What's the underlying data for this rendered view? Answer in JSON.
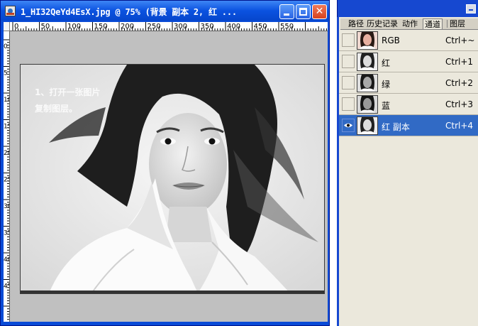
{
  "window": {
    "title": "1_HI32QeYd4EsX.jpg @ 75% (背景 副本 2, 红 ...",
    "minimize_glyph": "_",
    "maximize_glyph": "□",
    "close_glyph": "✕"
  },
  "rulers": {
    "horizontal_labels": [
      "0",
      "50",
      "100",
      "150",
      "200",
      "250",
      "300",
      "350",
      "400",
      "450",
      "550"
    ],
    "vertical_labels": [
      "0",
      "5",
      "10",
      "15",
      "20",
      "25",
      "30",
      "35",
      "40",
      "45"
    ]
  },
  "image": {
    "caption_lines": [
      "1、打开一张图片",
      "复制图层。"
    ]
  },
  "panel": {
    "tabs": [
      "路径",
      "历史记录",
      "动作",
      "通道",
      "图层"
    ],
    "active_tab": "通道",
    "channels": [
      {
        "name": "RGB",
        "shortcut": "Ctrl+~",
        "visible": false,
        "selected": false,
        "thumb": "color"
      },
      {
        "name": "红",
        "shortcut": "Ctrl+1",
        "visible": false,
        "selected": false,
        "thumb": "gray"
      },
      {
        "name": "绿",
        "shortcut": "Ctrl+2",
        "visible": false,
        "selected": false,
        "thumb": "gray"
      },
      {
        "name": "蓝",
        "shortcut": "Ctrl+3",
        "visible": false,
        "selected": false,
        "thumb": "gray"
      },
      {
        "name": "红 副本",
        "shortcut": "Ctrl+4",
        "visible": true,
        "selected": true,
        "thumb": "gray"
      }
    ]
  },
  "colors": {
    "title_bar": "#0b52e0",
    "panel_bg": "#ebe8dc",
    "selection": "#316ac5",
    "canvas_bg": "#c0c0c0"
  }
}
